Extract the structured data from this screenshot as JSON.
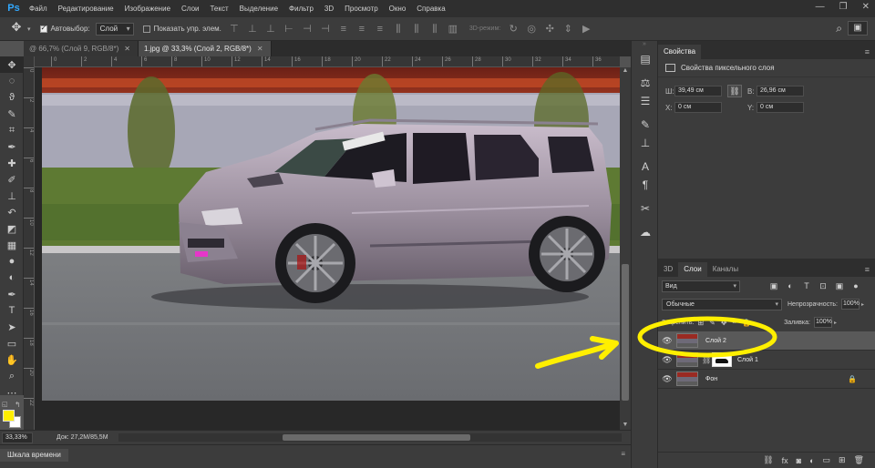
{
  "app": {
    "logo": "Ps"
  },
  "menu": [
    "Файл",
    "Редактирование",
    "Изображение",
    "Слои",
    "Текст",
    "Выделение",
    "Фильтр",
    "3D",
    "Просмотр",
    "Окно",
    "Справка"
  ],
  "window_controls": [
    "—",
    "❐",
    "✕"
  ],
  "options_bar": {
    "autoselect_label": "Автовыбор:",
    "autoselect_value": "Слой",
    "show_transform_label": "Показать упр. элем.",
    "mode_3d_label": "3D-режим:",
    "workspace_icon": "▣"
  },
  "tabs": [
    {
      "label": "@ 66,7% (Слой 9, RGB/8*)",
      "active": false
    },
    {
      "label": "1.jpg @ 33,3% (Слой 2, RGB/8*)",
      "active": true
    }
  ],
  "ruler": {
    "h_ticks": [
      "0",
      "2",
      "4",
      "6",
      "8",
      "10",
      "12",
      "14",
      "16",
      "18",
      "20",
      "22",
      "24",
      "26",
      "28",
      "30",
      "32",
      "34",
      "36"
    ],
    "v_ticks": [
      "0",
      "2",
      "4",
      "6",
      "8",
      "10",
      "12",
      "14",
      "16",
      "18",
      "20",
      "22"
    ]
  },
  "status": {
    "zoom": "33,33%",
    "doc_info": "Док: 27,2M/85,5M",
    "arrow": "▸"
  },
  "timeline": {
    "tab_label": "Шкала времени"
  },
  "properties": {
    "tab_label": "Свойства",
    "title": "Свойства пиксельного слоя",
    "w_label": "Ш:",
    "w_value": "39,49 см",
    "h_label": "В:",
    "h_value": "26,96 см",
    "x_label": "X:",
    "x_value": "0 см",
    "y_label": "Y:",
    "y_value": "0 см",
    "link_icon": "⛓"
  },
  "layers_panel": {
    "tabs": [
      {
        "label": "3D",
        "active": false
      },
      {
        "label": "Слои",
        "active": true
      },
      {
        "label": "Каналы",
        "active": false
      }
    ],
    "kind_select": "Вид",
    "blend_mode": "Обычные",
    "opacity_label": "Непрозрачность:",
    "opacity_value": "100%",
    "lock_label": "Закрепить:",
    "fill_label": "Заливка:",
    "fill_value": "100%",
    "layers": [
      {
        "name": "Слой 2",
        "visible": true,
        "selected": true,
        "mask": false,
        "locked": false
      },
      {
        "name": "Слой 1",
        "visible": true,
        "selected": false,
        "mask": true,
        "locked": false
      },
      {
        "name": "Фон",
        "visible": true,
        "selected": false,
        "mask": false,
        "locked": true
      }
    ],
    "footer_icons": [
      "link-icon",
      "fx-icon",
      "mask-icon",
      "adjustment-icon",
      "folder-icon",
      "new-layer-icon",
      "trash-icon"
    ]
  },
  "colors": {
    "foreground": "#ffef00",
    "background": "#ffffff",
    "annotation": "#ffef00",
    "accent_logo": "#31a8ff"
  }
}
